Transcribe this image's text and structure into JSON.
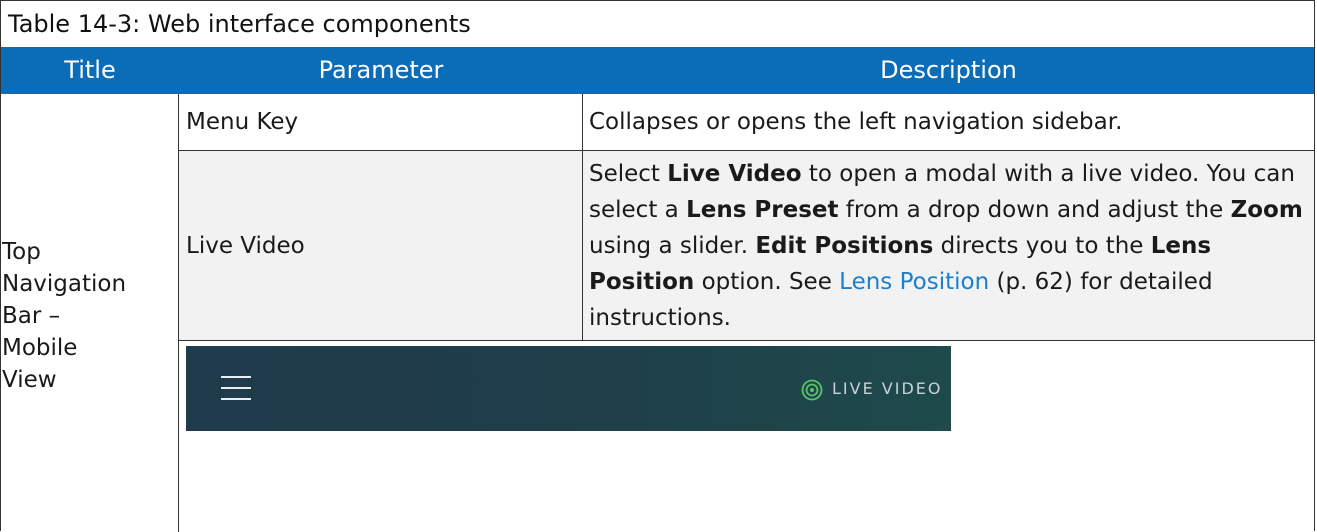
{
  "caption": "Table 14-3: Web interface components",
  "headers": {
    "title": "Title",
    "parameter": "Parameter",
    "description": "Description"
  },
  "group_title": {
    "line1": "Top",
    "line2": "Navigation",
    "line3": "Bar –",
    "line4": "Mobile",
    "line5": "View"
  },
  "rows": [
    {
      "parameter": "Menu Key",
      "description": "Collapses or opens the left navigation sidebar."
    },
    {
      "parameter": "Live Video",
      "description_parts": {
        "p1": "Select ",
        "b1": "Live Video",
        "p2": " to open a modal with a live video. You can select a ",
        "b2": "Lens Preset",
        "p3": " from a drop down and adjust the ",
        "b3": "Zoom",
        "p4": " using a slider. ",
        "b4": "Edit Positions",
        "p5": " directs you to the ",
        "b5": "Lens Position",
        "p6": " option. See ",
        "link": "Lens Position",
        "p7": " (p. 62) for detailed instructions."
      }
    }
  ],
  "navbar_image": {
    "menu_icon": "hamburger-icon",
    "live_icon": "live-stream-icon",
    "live_label": "LIVE VIDEO"
  },
  "colors": {
    "header_bg": "#0b6db7",
    "link": "#1c7fcb",
    "navbar_bg": "#203b4c"
  }
}
